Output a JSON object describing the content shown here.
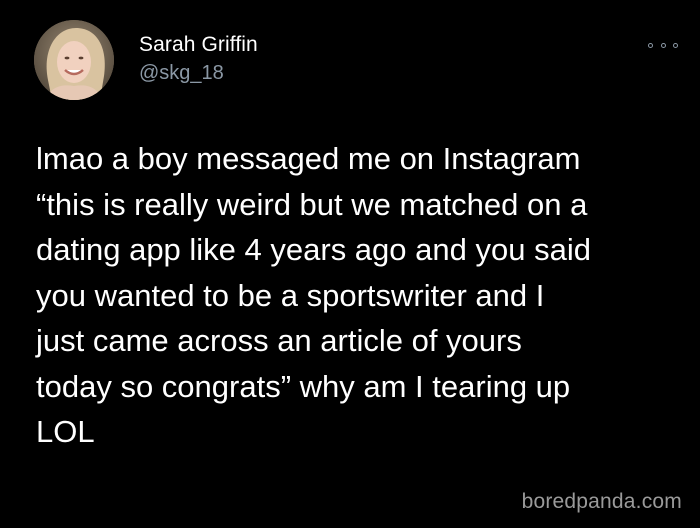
{
  "user": {
    "display_name": "Sarah Griffin",
    "handle": "@skg_18",
    "avatar_icon": "profile-photo"
  },
  "more_icon": "ellipsis-icon",
  "tweet": {
    "lines": [
      "lmao a boy messaged me on Instagram",
      "“this is really weird but we matched on a",
      "dating app like 4 years ago and you said",
      "you wanted to be a sportswriter and I",
      "just came across an article of yours",
      "today so congrats” why am I tearing up",
      "LOL"
    ]
  },
  "watermark": "boredpanda.com",
  "colors": {
    "background": "#000000",
    "text": "#ffffff",
    "secondary_text": "#8b98a5",
    "watermark": "#9a9a9a"
  }
}
